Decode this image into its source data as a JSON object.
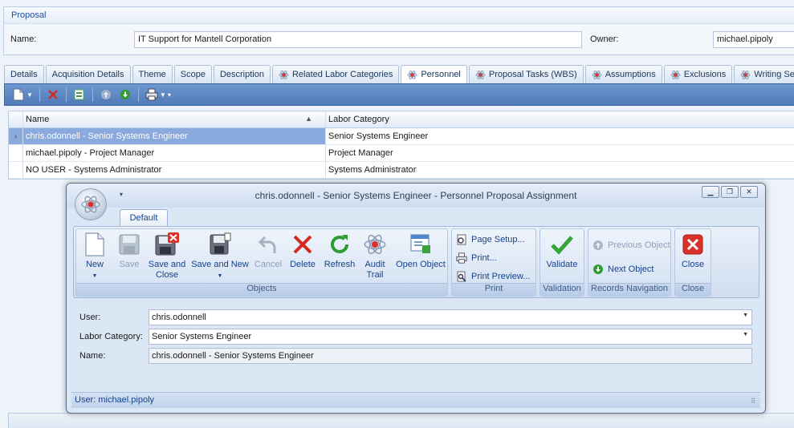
{
  "proposal": {
    "group_title": "Proposal",
    "name_label": "Name:",
    "name_value": "IT Support for Mantell Corporation",
    "owner_label": "Owner:",
    "owner_value": "michael.pipoly"
  },
  "tabs": [
    {
      "label": "Details",
      "icon": false
    },
    {
      "label": "Acquisition Details",
      "icon": false
    },
    {
      "label": "Theme",
      "icon": false
    },
    {
      "label": "Scope",
      "icon": false
    },
    {
      "label": "Description",
      "icon": false
    },
    {
      "label": "Related Labor Categories",
      "icon": true
    },
    {
      "label": "Personnel",
      "icon": true,
      "active": true
    },
    {
      "label": "Proposal Tasks (WBS)",
      "icon": true
    },
    {
      "label": "Assumptions",
      "icon": true
    },
    {
      "label": "Exclusions",
      "icon": true
    },
    {
      "label": "Writing Sect",
      "icon": true
    }
  ],
  "grid": {
    "columns": [
      "Name",
      "Labor Category"
    ],
    "rows": [
      {
        "name": "chris.odonnell - Senior Systems Engineer",
        "category": "Senior Systems Engineer",
        "selected": true
      },
      {
        "name": "michael.pipoly - Project Manager",
        "category": "Project Manager"
      },
      {
        "name": "NO USER - Systems Administrator",
        "category": "Systems Administrator"
      }
    ]
  },
  "dialog": {
    "title": "chris.odonnell - Senior Systems Engineer - Personnel Proposal Assignment",
    "ribbon_tab": "Default",
    "groups": {
      "objects": {
        "label": "Objects",
        "new": "New",
        "save": "Save",
        "save_close_1": "Save and",
        "save_close_2": "Close",
        "save_new": "Save and New",
        "cancel": "Cancel",
        "delete": "Delete",
        "refresh": "Refresh",
        "audit_1": "Audit",
        "audit_2": "Trail",
        "open_object": "Open Object"
      },
      "print": {
        "label": "Print",
        "page_setup": "Page Setup...",
        "print": "Print...",
        "print_preview": "Print Preview..."
      },
      "validation": {
        "label": "Validation",
        "validate": "Validate"
      },
      "records": {
        "label": "Records Navigation",
        "previous": "Previous Object",
        "next": "Next Object"
      },
      "close": {
        "label": "Close",
        "close": "Close"
      }
    },
    "form": {
      "user_label": "User:",
      "user_value": "chris.odonnell",
      "labor_label": "Labor Category:",
      "labor_value": "Senior Systems Engineer",
      "name_label": "Name:",
      "name_value": "chris.odonnell - Senior Systems Engineer"
    },
    "status": "User: michael.pipoly"
  }
}
